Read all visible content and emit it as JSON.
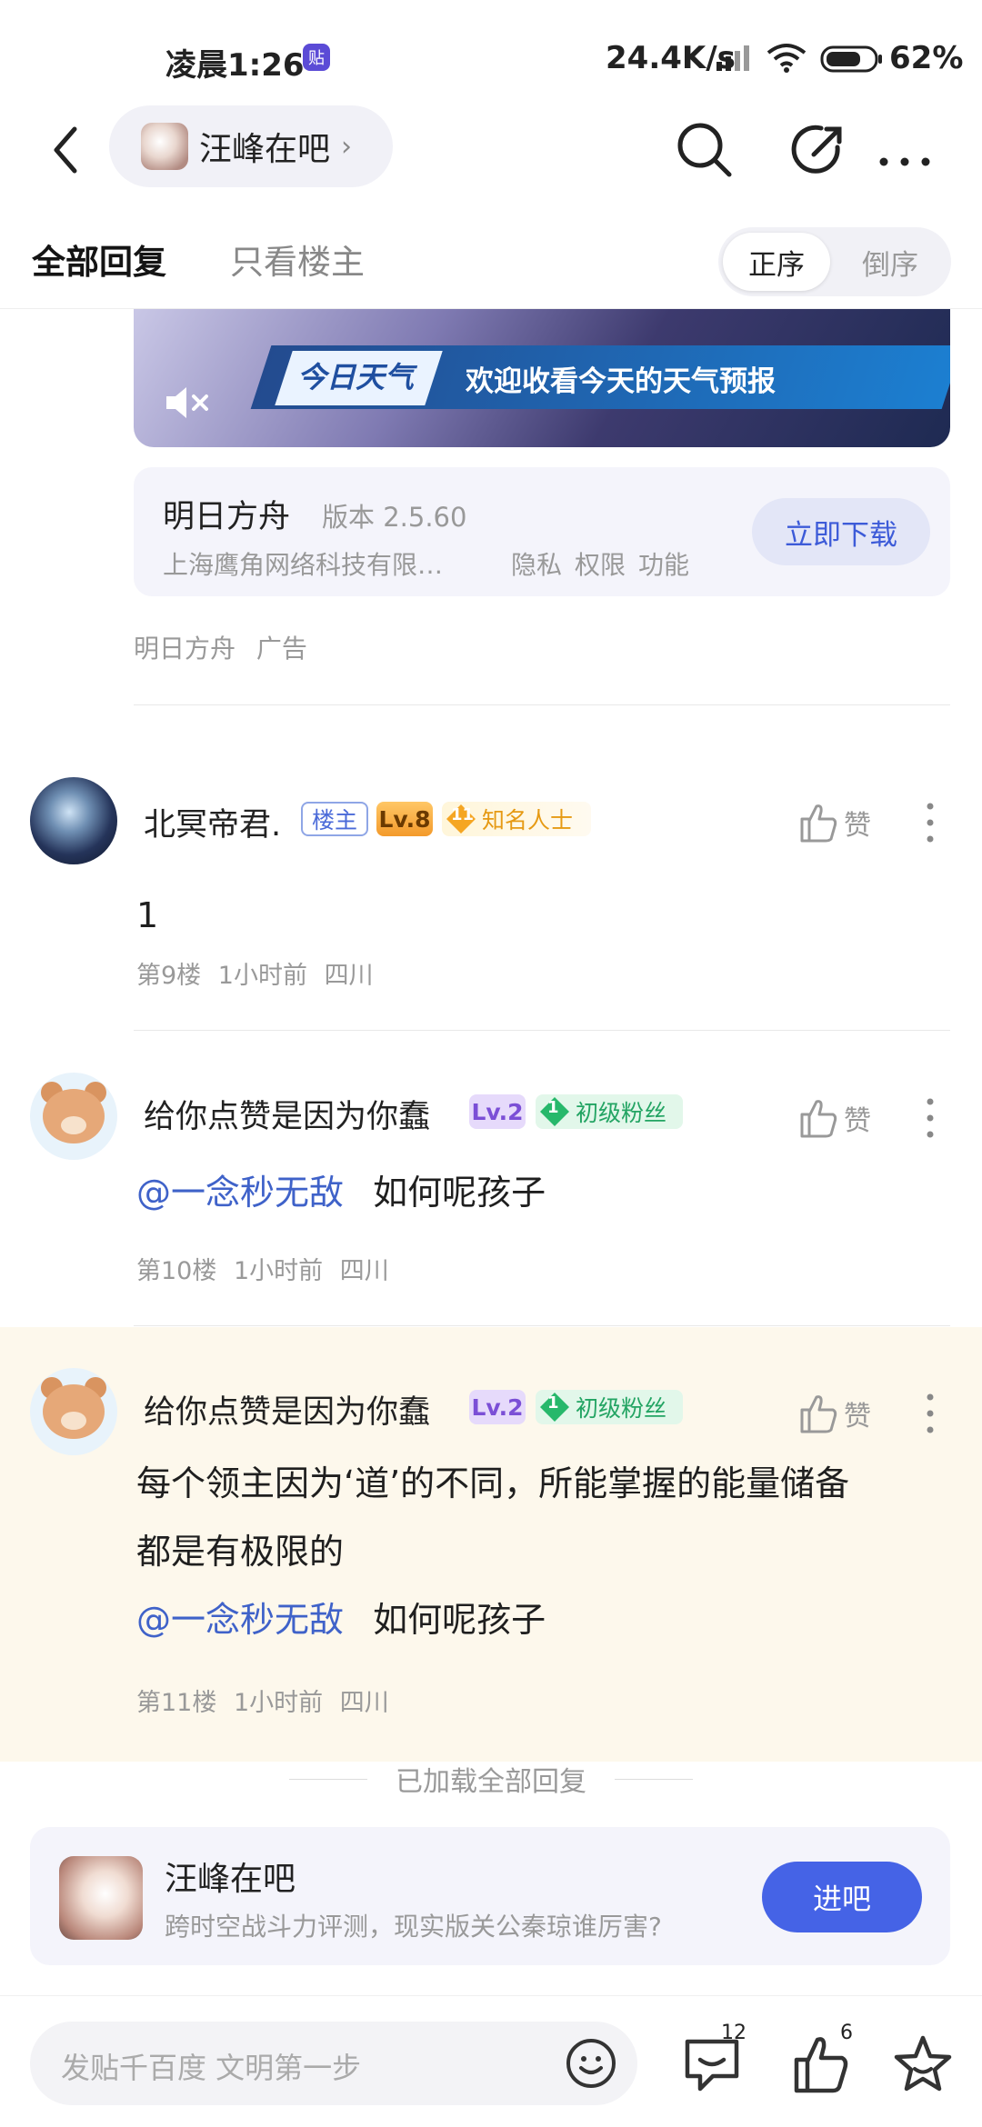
{
  "status_bar": {
    "time": "凌晨1:26",
    "app_badge": "贴",
    "speed": "24.4K/s",
    "battery": "62%"
  },
  "header": {
    "forum_name": "汪峰在吧",
    "chevron": "›"
  },
  "tabs": {
    "all_replies": "全部回复",
    "only_op": "只看楼主",
    "sort_asc": "正序",
    "sort_desc": "倒序"
  },
  "ad": {
    "banner_tag": "今日天气",
    "banner_text": "欢迎收看今天的天气预报",
    "app_name": "明日方舟",
    "version": "版本 2.5.60",
    "company": "上海鹰角网络科技有限…",
    "links": [
      "隐私",
      "权限",
      "功能"
    ],
    "download_label": "立即下载",
    "source": "明日方舟",
    "ad_label": "广告"
  },
  "posts": [
    {
      "username": "北冥帝君.",
      "owner_badge": "楼主",
      "level": "Lv.8",
      "title_num": "11",
      "title": "知名人士",
      "like_label": "赞",
      "content": "1",
      "floor": "第9楼",
      "time": "1小时前",
      "location": "四川"
    },
    {
      "username": "给你点赞是因为你蠢",
      "level": "Lv.2",
      "title_num": "1",
      "title": "初级粉丝",
      "like_label": "赞",
      "mention": "@一念秒无敌",
      "content": "如何呢孩子",
      "floor": "第10楼",
      "time": "1小时前",
      "location": "四川"
    },
    {
      "username": "给你点赞是因为你蠢",
      "level": "Lv.2",
      "title_num": "1",
      "title": "初级粉丝",
      "like_label": "赞",
      "content_line1": "每个领主因为‘道’的不同，所能掌握的能量储备",
      "content_line2": "都是有极限的",
      "mention": "@一念秒无敌",
      "content": "如何呢孩子",
      "floor": "第11楼",
      "time": "1小时前",
      "location": "四川"
    }
  ],
  "loaded_text": "已加载全部回复",
  "forum_card": {
    "name": "汪峰在吧",
    "desc": "跨时空战斗力评测，现实版关公秦琼谁厉害?",
    "enter_label": "进吧"
  },
  "bottom_bar": {
    "placeholder": "发贴千百度 文明第一步",
    "comment_count": "12",
    "like_count": "6"
  },
  "colors": {
    "accent": "#4563e6",
    "mention": "#3f62c9",
    "highlight_bg": "#fdf8ec"
  }
}
